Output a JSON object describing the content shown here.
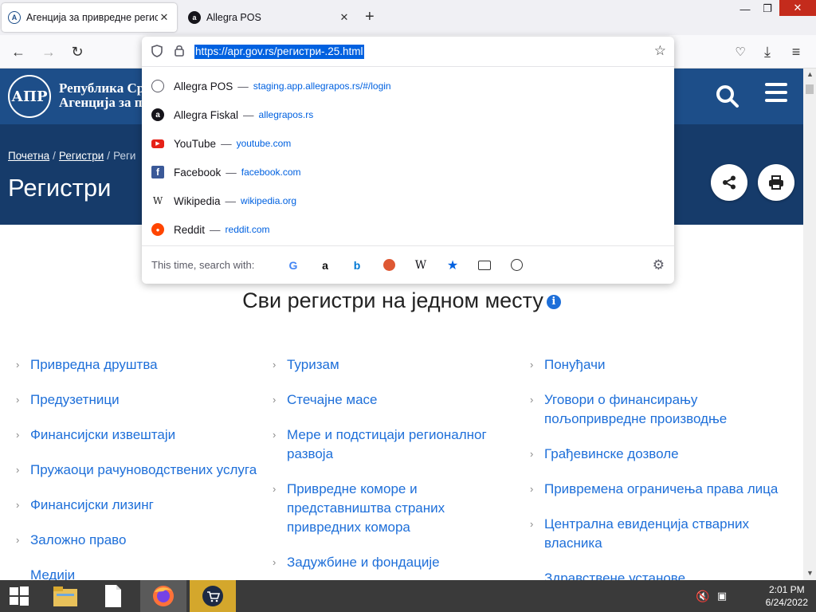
{
  "browser": {
    "tabs": [
      {
        "title": "Агенција за привредне регист",
        "active": true
      },
      {
        "title": "Allegra POS",
        "active": false
      }
    ],
    "url": "https://apr.gov.rs/регистри-.25.html",
    "suggestions": [
      {
        "name": "Allegra POS",
        "url": "staging.app.allegrapos.rs/#/login",
        "icon": "globe-icon"
      },
      {
        "name": "Allegra Fiskal",
        "url": "allegrapos.rs",
        "icon": "allegra-icon"
      },
      {
        "name": "YouTube",
        "url": "youtube.com",
        "icon": "youtube-icon"
      },
      {
        "name": "Facebook",
        "url": "facebook.com",
        "icon": "facebook-icon"
      },
      {
        "name": "Wikipedia",
        "url": "wikipedia.org",
        "icon": "wikipedia-icon"
      },
      {
        "name": "Reddit",
        "url": "reddit.com",
        "icon": "reddit-icon"
      }
    ],
    "dash": "—",
    "search_with_label": "This time, search with:"
  },
  "page": {
    "org_name_line1": "Република Ср",
    "org_name_line2": "Агенција за пр",
    "logo_text": "АПР",
    "breadcrumb": {
      "home": "Почетна",
      "registers": "Регистри",
      "separator": "/",
      "current": "Реги"
    },
    "title": "Регистри",
    "section_title": "Сви регистри на једном месту",
    "info_glyph": "i",
    "columns": [
      [
        "Привредна друштва",
        "Предузетници",
        "Финансијски извештаји",
        "Пружаоци рачуноводствених услуга",
        "Финансијски лизинг",
        "Заложно право",
        "Медији"
      ],
      [
        "Туризам",
        "Стечајне масе",
        "Мере и подстицаји регионалног развоја",
        "Привредне коморе и представништва страних привредних комора",
        "Задужбине и фондације"
      ],
      [
        "Понуђачи",
        "Уговори о финансирању пољопривредне производње",
        "Грађевинске дозволе",
        "Привремена ограничења права лица",
        "Централна евиденција стварних власника",
        "Здравствене установе"
      ]
    ]
  },
  "taskbar": {
    "time": "2:01 PM",
    "date": "6/24/2022"
  }
}
